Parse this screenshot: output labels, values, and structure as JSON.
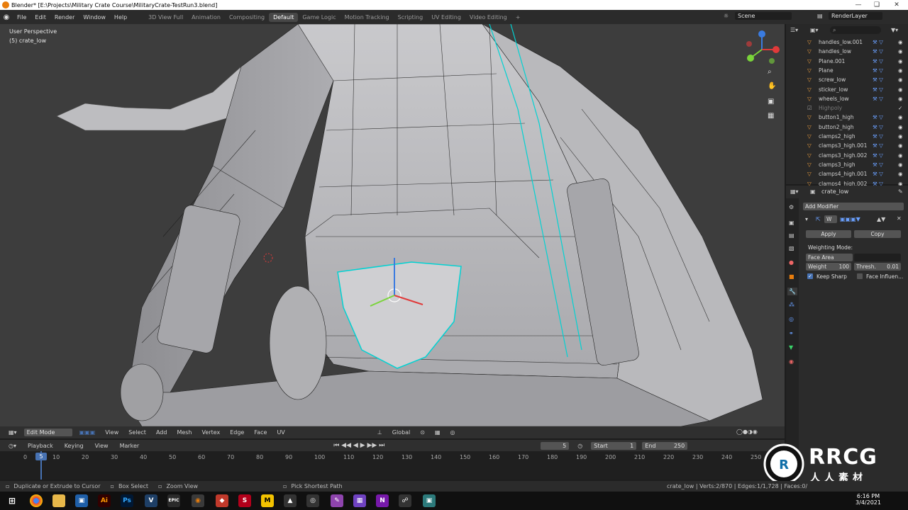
{
  "window": {
    "title": "Blender* [E:\\Projects\\Military Crate Course\\MilitaryCrate-TestRun3.blend]"
  },
  "menu": [
    "File",
    "Edit",
    "Render",
    "Window",
    "Help"
  ],
  "workspaces": [
    {
      "label": "3D View Full",
      "active": false
    },
    {
      "label": "Animation",
      "active": false
    },
    {
      "label": "Compositing",
      "active": false
    },
    {
      "label": "Default",
      "active": true
    },
    {
      "label": "Game Logic",
      "active": false
    },
    {
      "label": "Motion Tracking",
      "active": false
    },
    {
      "label": "Scripting",
      "active": false
    },
    {
      "label": "UV Editing",
      "active": false
    },
    {
      "label": "Video Editing",
      "active": false
    }
  ],
  "scene": {
    "scene_name": "Scene",
    "render_layer": "RenderLayer"
  },
  "viewport": {
    "perspective": "User Perspective",
    "object": "(5) crate_low",
    "header": {
      "mode": "Edit Mode",
      "menus": [
        "View",
        "Select",
        "Add",
        "Mesh",
        "Vertex",
        "Edge",
        "Face",
        "UV"
      ],
      "orientation": "Global"
    }
  },
  "outliner": {
    "items": [
      {
        "label": "handles_low.001",
        "dim": false
      },
      {
        "label": "handles_low",
        "dim": false
      },
      {
        "label": "Plane.001",
        "dim": false
      },
      {
        "label": "Plane",
        "dim": false
      },
      {
        "label": "screw_low",
        "dim": false
      },
      {
        "label": "sticker_low",
        "dim": false
      },
      {
        "label": "wheels_low",
        "dim": false
      },
      {
        "label": "Highpoly",
        "dim": true
      },
      {
        "label": "button1_high",
        "dim": false
      },
      {
        "label": "button2_high",
        "dim": false
      },
      {
        "label": "clamps2_high",
        "dim": false
      },
      {
        "label": "clamps3_high.001",
        "dim": false
      },
      {
        "label": "clamps3_high.002",
        "dim": false
      },
      {
        "label": "clamps3_high",
        "dim": false
      },
      {
        "label": "clamps4_high.001",
        "dim": false
      },
      {
        "label": "clamps4_high.002",
        "dim": false
      }
    ]
  },
  "properties": {
    "object_name": "crate_low",
    "add_modifier": "Add Modifier",
    "modifier_name": "W",
    "apply": "Apply",
    "copy": "Copy",
    "weighting_mode_label": "Weighting Mode:",
    "weighting_mode": "Face Area",
    "weight_label": "Weight",
    "weight_value": "100",
    "threshold_label": "Thresh.",
    "threshold_value": "0.01",
    "keep_sharp": "Keep Sharp",
    "keep_sharp_checked": true,
    "face_influence": "Face Influen...",
    "face_influence_checked": false
  },
  "timeline": {
    "menus": [
      "Playback",
      "Keying",
      "View",
      "Marker"
    ],
    "current_frame": "5",
    "start_label": "Start",
    "start": "1",
    "end_label": "End",
    "end": "250",
    "ticks": [
      "0",
      "5",
      "10",
      "20",
      "30",
      "40",
      "50",
      "60",
      "70",
      "80",
      "90",
      "100",
      "110",
      "120",
      "130",
      "140",
      "150",
      "160",
      "170",
      "180",
      "190",
      "200",
      "210",
      "220",
      "230",
      "240",
      "250"
    ]
  },
  "statusbar": {
    "hint1": "Duplicate or Extrude to Cursor",
    "hint2": "Box Select",
    "hint3": "Zoom View",
    "hint4": "Pick Shortest Path",
    "stats": "crate_low | Verts:2/870 | Edges:1/1,728 | Faces:0/"
  },
  "taskbar": {
    "time": "6:16 PM",
    "date": "3/4/2021"
  },
  "watermark": {
    "brand": "RRCG",
    "sub": "人人素材"
  },
  "colors": {
    "accent": "#4772b3",
    "selection": "#00d2d2",
    "viewport_bg": "#3d3d3d"
  }
}
